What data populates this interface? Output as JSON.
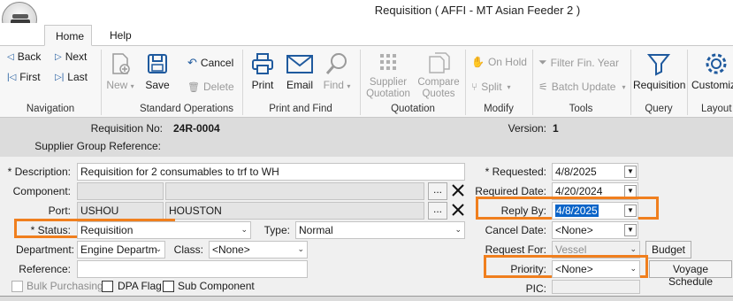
{
  "window": {
    "title": "Requisition ( AFFI - MT Asian Feeder 2 )"
  },
  "tabs": {
    "home": "Home",
    "help": "Help"
  },
  "ribbon": {
    "navigation": {
      "back": "Back",
      "next": "Next",
      "first": "First",
      "last": "Last",
      "group": "Navigation"
    },
    "standard": {
      "new": "New",
      "save": "Save",
      "cancel": "Cancel",
      "delete": "Delete",
      "group": "Standard Operations"
    },
    "print_find": {
      "print": "Print",
      "email": "Email",
      "find": "Find",
      "group": "Print and Find"
    },
    "quotation": {
      "supplier_line1": "Supplier",
      "supplier_line2": "Quotation",
      "compare_line1": "Compare",
      "compare_line2": "Quotes",
      "group": "Quotation"
    },
    "modify": {
      "on_hold": "On Hold",
      "split": "Split",
      "group": "Modify"
    },
    "tools": {
      "filter": "Filter Fin. Year",
      "batch": "Batch Update",
      "group": "Tools"
    },
    "query": {
      "requisition": "Requisition",
      "group": "Query"
    },
    "layout": {
      "customize": "Customiz",
      "group": "Layout"
    }
  },
  "header": {
    "req_no_label": "Requisition No:",
    "req_no_value": "24R-0004",
    "version_label": "Version:",
    "version_value": "1",
    "supplier_group_label": "Supplier Group Reference:"
  },
  "form": {
    "description_label": "* Description:",
    "description_value": "Requisition for 2 consumables to trf to WH",
    "component_label": "Component:",
    "port_label": "Port:",
    "port_code": "USHOU",
    "port_name": "HOUSTON",
    "ellipsis": "...",
    "status_label": "* Status:",
    "status_value": "Requisition",
    "type_label": "Type:",
    "type_value": "Normal",
    "department_label": "Department:",
    "department_value": "Engine Departm",
    "class_label": "Class:",
    "class_value": "<None>",
    "reference_label": "Reference:",
    "bulk_label": "Bulk Purchasing",
    "dpa_label": "DPA Flag",
    "sub_label": "Sub Component",
    "requested_label": "* Requested:",
    "requested_value": "4/8/2025",
    "required_label": "Required Date:",
    "required_value": "4/20/2024",
    "reply_label": "Reply By:",
    "reply_value": "4/8/2025",
    "cancel_date_label": "Cancel Date:",
    "cancel_date_value": "<None>",
    "request_for_label": "Request For:",
    "request_for_value": "Vessel",
    "budget_button": "Budget",
    "priority_label": "Priority:",
    "priority_value": "<None>",
    "voyage_button": "Voyage Schedule",
    "pic_label": "PIC:"
  },
  "colors": {
    "highlight": "#f07f1e",
    "selection": "#0a64c8",
    "icon_blue": "#1f5a9e"
  }
}
